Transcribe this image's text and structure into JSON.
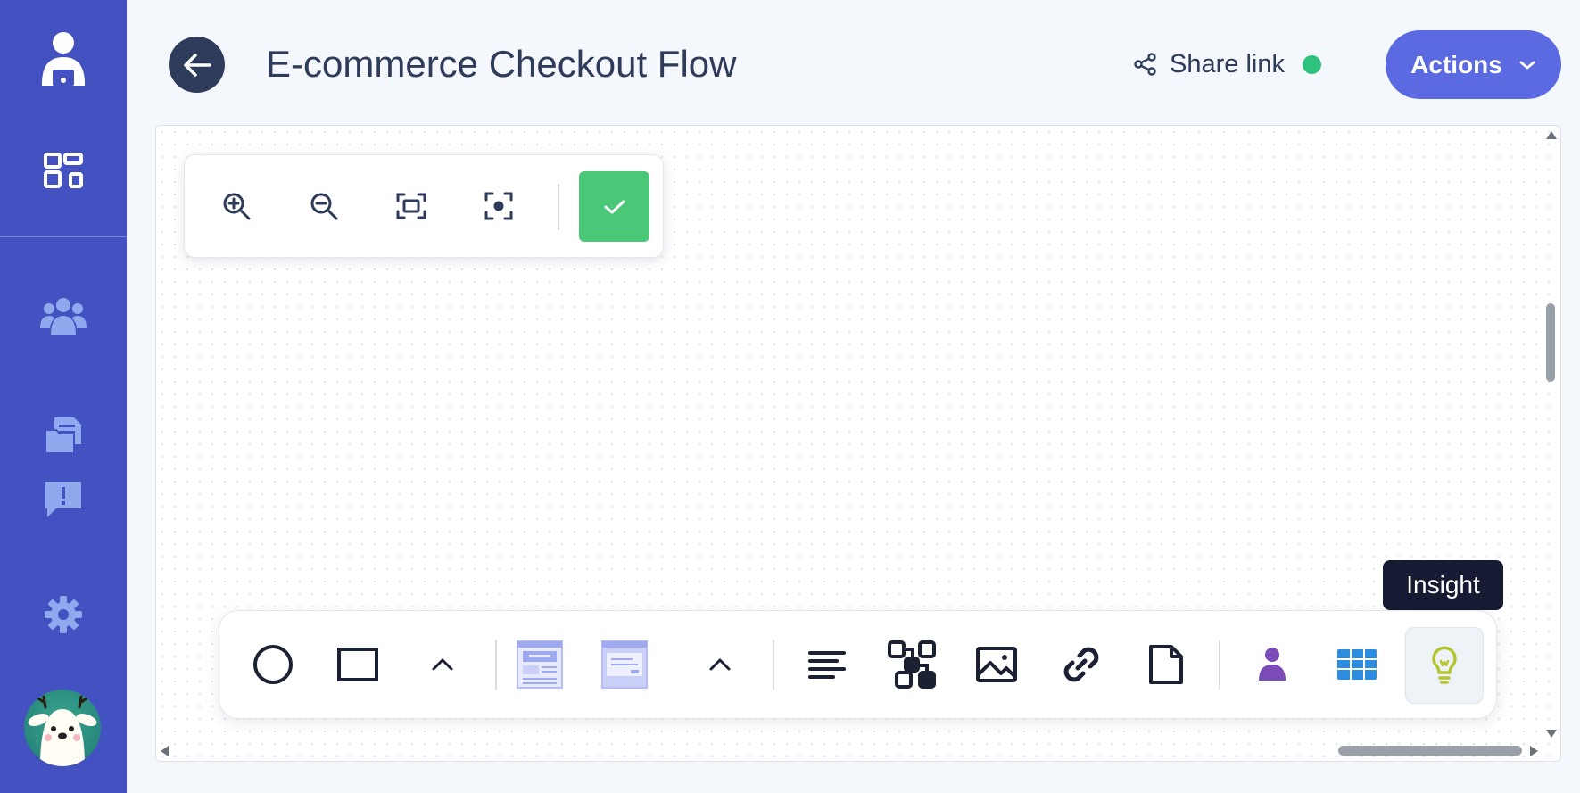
{
  "header": {
    "title": "E-commerce Checkout Flow",
    "share_label": "Share link",
    "actions_label": "Actions"
  },
  "sidebar": {
    "items": [
      {
        "icon": "user-logo-icon"
      },
      {
        "icon": "dashboard-icon"
      },
      {
        "icon": "team-icon"
      },
      {
        "icon": "documents-icon"
      },
      {
        "icon": "feedback-icon"
      },
      {
        "icon": "settings-icon"
      }
    ]
  },
  "zoom_toolbar": {
    "buttons": [
      "zoom-in-icon",
      "zoom-out-icon",
      "fit-to-screen-icon",
      "center-focus-icon"
    ],
    "confirm_color": "#4ac777"
  },
  "bottom_toolbar": {
    "active_tool": "insight",
    "tooltip": "Insight",
    "tools": [
      "circle",
      "rectangle",
      "expand-shapes",
      "wireframe-page",
      "wireframe-dialog",
      "expand-wireframes",
      "text",
      "flow",
      "image",
      "link",
      "document",
      "persona",
      "table",
      "insight"
    ]
  },
  "colors": {
    "sidebar": "#4352c0",
    "accent": "#5b6ae0",
    "status_online": "#2ec27e",
    "persona": "#7b4bb8",
    "table": "#2b8ce0",
    "insight": "#b5c532"
  }
}
